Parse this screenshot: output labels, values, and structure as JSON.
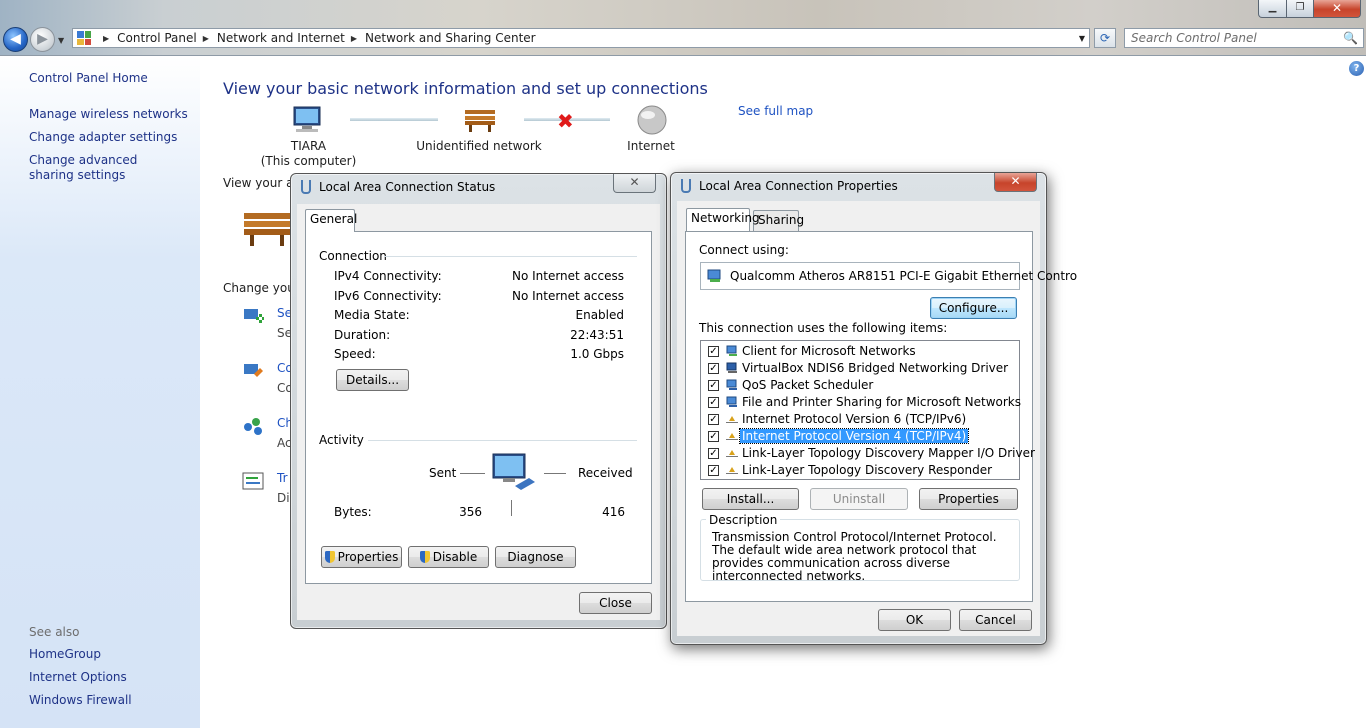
{
  "titlebar": {
    "min_glyph": "▁",
    "max_glyph": "❐",
    "close_glyph": "✕"
  },
  "nav": {
    "back_glyph": "◀",
    "fwd_glyph": "▶",
    "recent_glyph": "▼",
    "refresh_glyph": "⟳"
  },
  "address": {
    "crumbs": [
      "Control Panel",
      "Network and Internet",
      "Network and Sharing Center"
    ],
    "sep_glyph": "▶",
    "drop_glyph": "▼"
  },
  "search": {
    "placeholder": "Search Control Panel",
    "icon": "🔍"
  },
  "left_pane": {
    "home": "Control Panel Home",
    "links": [
      "Manage wireless networks",
      "Change adapter settings",
      "Change advanced sharing settings"
    ],
    "see_also_label": "See also",
    "see_also": [
      "HomeGroup",
      "Internet Options",
      "Windows Firewall"
    ]
  },
  "main": {
    "help_glyph": "?",
    "title": "View your basic network information and set up connections",
    "see_full_map": "See full map",
    "map": {
      "computer": {
        "name": "TIARA",
        "sub": "(This computer)"
      },
      "network": "Unidentified network",
      "internet": "Internet",
      "x_glyph": "✖"
    },
    "view_active_partial": "View your ac",
    "change_settings_partial": "Change your",
    "tasks": [
      {
        "title": "Se",
        "desc": "Se"
      },
      {
        "title": "Co",
        "desc": "Co"
      },
      {
        "title": "Ch",
        "desc": "Ac"
      },
      {
        "title": "Tr",
        "desc": "Di"
      }
    ]
  },
  "status_dialog": {
    "title": "Local Area Connection Status",
    "close_glyph": "✕",
    "tab": "General",
    "connection_header": "Connection",
    "rows": [
      {
        "label": "IPv4 Connectivity:",
        "value": "No Internet access"
      },
      {
        "label": "IPv6 Connectivity:",
        "value": "No Internet access"
      },
      {
        "label": "Media State:",
        "value": "Enabled"
      },
      {
        "label": "Duration:",
        "value": "22:43:51"
      },
      {
        "label": "Speed:",
        "value": "1.0 Gbps"
      }
    ],
    "details_button": "Details...",
    "activity_header": "Activity",
    "sent_label": "Sent",
    "received_label": "Received",
    "bytes_label": "Bytes:",
    "bytes_sent": "356",
    "bytes_received": "416",
    "properties_button": "Properties",
    "disable_button": "Disable",
    "diagnose_button": "Diagnose",
    "close_button": "Close"
  },
  "props_dialog": {
    "title": "Local Area Connection Properties",
    "close_glyph": "✕",
    "tabs": [
      "Networking",
      "Sharing"
    ],
    "connect_using_label": "Connect using:",
    "adapter": "Qualcomm Atheros AR8151 PCI-E Gigabit Ethernet Contro",
    "configure_button": "Configure...",
    "items_label": "This connection uses the following items:",
    "items": [
      {
        "label": "Client for Microsoft Networks",
        "checked": true,
        "icon": "network-client-icon"
      },
      {
        "label": "VirtualBox NDIS6 Bridged Networking Driver",
        "checked": true,
        "icon": "network-driver-icon"
      },
      {
        "label": "QoS Packet Scheduler",
        "checked": true,
        "icon": "network-service-icon"
      },
      {
        "label": "File and Printer Sharing for Microsoft Networks",
        "checked": true,
        "icon": "network-service-icon"
      },
      {
        "label": "Internet Protocol Version 6 (TCP/IPv6)",
        "checked": true,
        "icon": "protocol-icon"
      },
      {
        "label": "Internet Protocol Version 4 (TCP/IPv4)",
        "checked": true,
        "icon": "protocol-icon",
        "selected": true
      },
      {
        "label": "Link-Layer Topology Discovery Mapper I/O Driver",
        "checked": true,
        "icon": "protocol-icon"
      },
      {
        "label": "Link-Layer Topology Discovery Responder",
        "checked": true,
        "icon": "protocol-icon"
      }
    ],
    "check_glyph": "✓",
    "install_button": "Install...",
    "uninstall_button": "Uninstall",
    "properties_button": "Properties",
    "description_header": "Description",
    "description": "Transmission Control Protocol/Internet Protocol. The default wide area network protocol that provides communication across diverse interconnected networks.",
    "ok_button": "OK",
    "cancel_button": "Cancel"
  },
  "colors": {
    "link": "#1e52c2",
    "nav_link": "#1e3287",
    "selection": "#3399ff",
    "x_mark": "#e01a1a"
  }
}
